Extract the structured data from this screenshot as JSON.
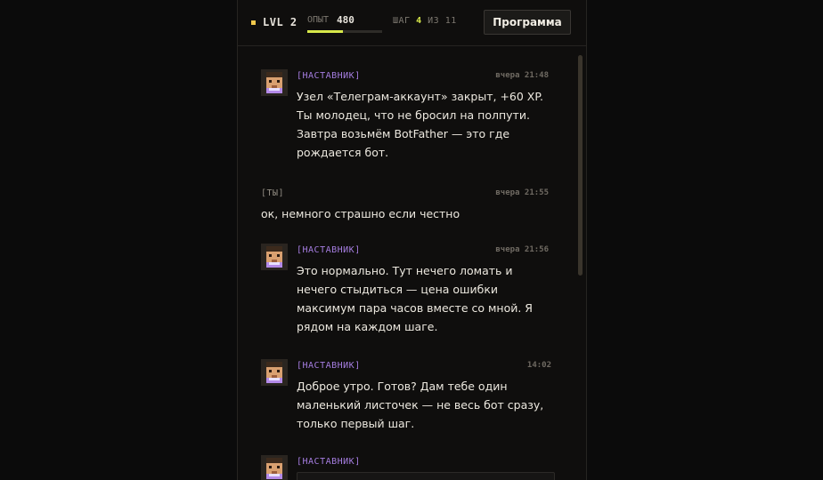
{
  "header": {
    "level_label": "LVL 2",
    "xp_label": "ОПЫТ",
    "xp_value": "480",
    "xp_progress": 0.48,
    "step_prefix": "ШАГ",
    "step_current": "4",
    "step_of": "ИЗ",
    "step_total": "11",
    "program_button": "Программа"
  },
  "messages": [
    {
      "author": "[НАСТАВНИК]",
      "time": "вчера 21:48",
      "text": "Узел «Телеграм-аккаунт» закрыт, +60 XP. Ты молодец, что не бросил на полпути. Завтра возьмём BotFather — это где рождается бот."
    },
    {
      "author": "[ТЫ]",
      "time": "вчера 21:55",
      "text": "ок, немного страшно если честно"
    },
    {
      "author": "[НАСТАВНИК]",
      "time": "вчера 21:56",
      "text": "Это нормально. Тут нечего ломать и нечего стыдиться — цена ошибки максимум пара часов вместе со мной. Я рядом на каждом шаге."
    },
    {
      "author": "[НАСТАВНИК]",
      "time": "14:02",
      "text": "Доброе утро. Готов? Дам тебе один маленький листочек — не весь бот сразу, только первый шаг."
    },
    {
      "author": "[НАСТАВНИК]"
    }
  ],
  "colors": {
    "accent_yellow": "#f2c94c",
    "xp_bar": "#d7e84a",
    "mentor_name": "#a57de0",
    "background": "#0b0b0b"
  }
}
